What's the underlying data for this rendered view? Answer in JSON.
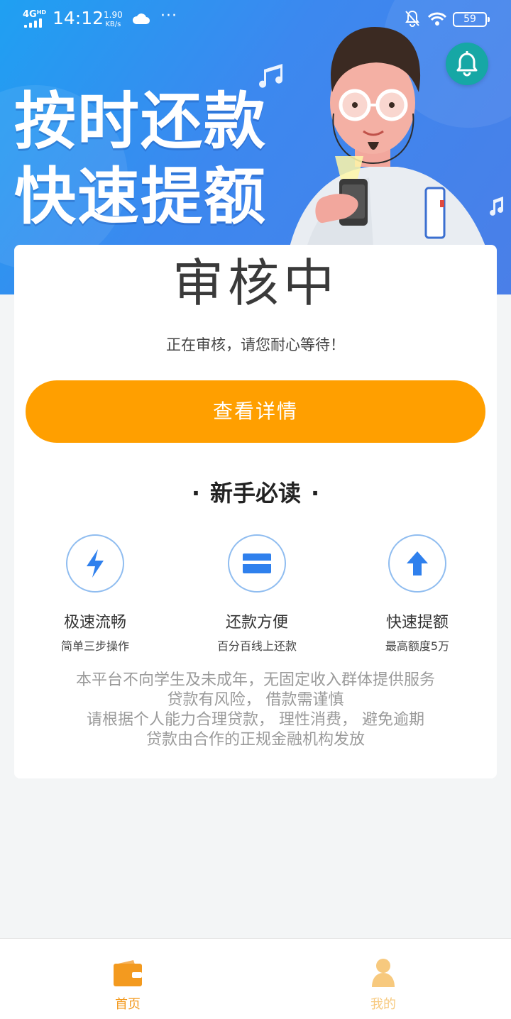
{
  "status_bar": {
    "network": "4G",
    "network_sup": "HD",
    "time": "14:12",
    "speed_value": "1.90",
    "speed_unit": "KB/s",
    "more": "···",
    "battery": "59"
  },
  "banner": {
    "line1": "按时还款",
    "line2": "快速提额"
  },
  "card": {
    "status_title": "审核中",
    "status_desc": "正在审核，请您耐心等待！",
    "detail_button": "查看详情",
    "guide_title": "新手必读",
    "features": [
      {
        "icon": "lightning-icon",
        "title": "极速流畅",
        "subtitle": "简单三步操作"
      },
      {
        "icon": "card-icon",
        "title": "还款方便",
        "subtitle": "百分百线上还款"
      },
      {
        "icon": "arrow-up-icon",
        "title": "快速提额",
        "subtitle": "最高额度5万"
      }
    ],
    "notice": [
      "本平台不向学生及未成年，无固定收入群体提供服务",
      "贷款有风险， 借款需谨慎",
      "请根据个人能力合理贷款， 理性消费， 避免逾期",
      "贷款由合作的正规金融机构发放"
    ]
  },
  "bottom_nav": {
    "home_label": "首页",
    "mine_label": "我的"
  },
  "colors": {
    "primary_orange": "#ff9f00",
    "nav_active": "#f39a1f",
    "nav_inactive": "#f7c97e",
    "banner_blue": "#3c88ef",
    "bell_teal": "#16a7a5",
    "feature_blue": "#2f80ed"
  }
}
